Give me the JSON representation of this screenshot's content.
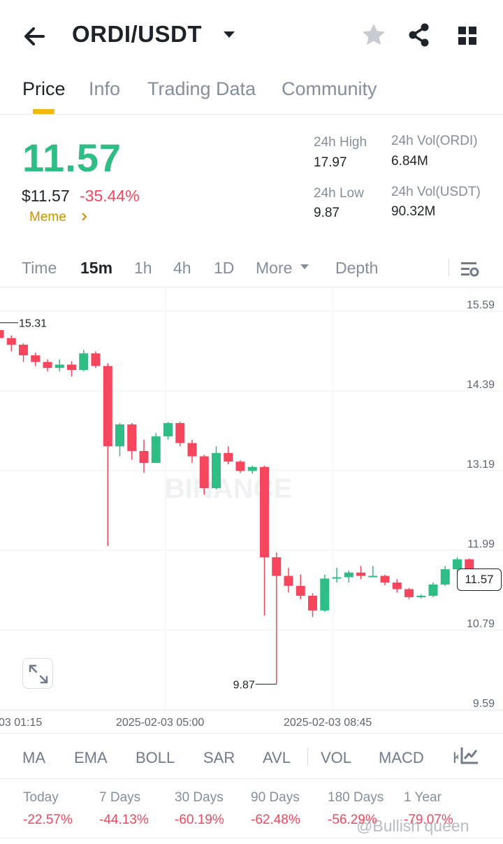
{
  "header": {
    "pair": "ORDI/USDT",
    "icons": [
      "back-arrow-icon",
      "caret-down-icon",
      "star-icon",
      "share-icon",
      "grid-icon"
    ]
  },
  "tabs": [
    {
      "label": "Price",
      "active": true
    },
    {
      "label": "Info",
      "active": false
    },
    {
      "label": "Trading Data",
      "active": false
    },
    {
      "label": "Community",
      "active": false
    }
  ],
  "price": {
    "last": "11.57",
    "usd": "$11.57",
    "change": "-35.44%",
    "tag": "Meme",
    "colors": {
      "up": "#2ebd85",
      "down": "#f6465d",
      "tag": "#c99400",
      "accent": "#f0b90b"
    }
  },
  "stats": {
    "high_label": "24h High",
    "high_value": "17.97",
    "low_label": "24h Low",
    "low_value": "9.87",
    "vol_base_label": "24h Vol(ORDI)",
    "vol_base_value": "6.84M",
    "vol_quote_label": "24h Vol(USDT)",
    "vol_quote_value": "90.32M"
  },
  "intervals": [
    {
      "label": "Time",
      "active": false
    },
    {
      "label": "15m",
      "active": true
    },
    {
      "label": "1h",
      "active": false
    },
    {
      "label": "4h",
      "active": false
    },
    {
      "label": "1D",
      "active": false
    },
    {
      "label": "More",
      "active": false
    },
    {
      "label": "Depth",
      "active": false
    }
  ],
  "chart_data": {
    "type": "candlestick",
    "y_ticks": [
      "15.59",
      "14.39",
      "13.19",
      "11.99",
      "10.79",
      "9.59"
    ],
    "ylim": [
      9.39,
      16.0
    ],
    "x_ticks": [
      "03 01:15",
      "2025-02-03 05:00",
      "2025-02-03 08:45"
    ],
    "high_marker": "15.31",
    "low_marker": "9.87",
    "last_price": "11.57",
    "watermark": "BINANCE",
    "candles": [
      {
        "o": 15.2,
        "h": 15.31,
        "l": 15.05,
        "c": 15.08
      },
      {
        "o": 15.08,
        "h": 15.12,
        "l": 14.88,
        "c": 14.98
      },
      {
        "o": 14.98,
        "h": 15.0,
        "l": 14.72,
        "c": 14.82
      },
      {
        "o": 14.82,
        "h": 14.86,
        "l": 14.66,
        "c": 14.72
      },
      {
        "o": 14.72,
        "h": 14.76,
        "l": 14.58,
        "c": 14.63
      },
      {
        "o": 14.63,
        "h": 14.76,
        "l": 14.58,
        "c": 14.68
      },
      {
        "o": 14.68,
        "h": 14.73,
        "l": 14.5,
        "c": 14.6
      },
      {
        "o": 14.6,
        "h": 14.9,
        "l": 14.58,
        "c": 14.85
      },
      {
        "o": 14.85,
        "h": 14.88,
        "l": 14.63,
        "c": 14.66
      },
      {
        "o": 14.66,
        "h": 14.7,
        "l": 11.95,
        "c": 13.45
      },
      {
        "o": 13.45,
        "h": 13.8,
        "l": 13.3,
        "c": 13.78
      },
      {
        "o": 13.78,
        "h": 13.8,
        "l": 13.25,
        "c": 13.38
      },
      {
        "o": 13.38,
        "h": 13.55,
        "l": 13.05,
        "c": 13.2
      },
      {
        "o": 13.2,
        "h": 13.65,
        "l": 13.2,
        "c": 13.6
      },
      {
        "o": 13.6,
        "h": 13.82,
        "l": 13.55,
        "c": 13.8
      },
      {
        "o": 13.8,
        "h": 13.82,
        "l": 13.45,
        "c": 13.5
      },
      {
        "o": 13.5,
        "h": 13.55,
        "l": 13.2,
        "c": 13.3
      },
      {
        "o": 13.3,
        "h": 13.32,
        "l": 12.72,
        "c": 12.82
      },
      {
        "o": 12.82,
        "h": 13.45,
        "l": 12.8,
        "c": 13.35
      },
      {
        "o": 13.35,
        "h": 13.45,
        "l": 13.18,
        "c": 13.22
      },
      {
        "o": 13.22,
        "h": 13.24,
        "l": 13.05,
        "c": 13.08
      },
      {
        "o": 13.08,
        "h": 13.16,
        "l": 13.04,
        "c": 13.14
      },
      {
        "o": 13.14,
        "h": 13.16,
        "l": 10.9,
        "c": 11.78
      },
      {
        "o": 11.78,
        "h": 11.85,
        "l": 9.87,
        "c": 11.5
      },
      {
        "o": 11.5,
        "h": 11.62,
        "l": 11.25,
        "c": 11.35
      },
      {
        "o": 11.35,
        "h": 11.52,
        "l": 11.15,
        "c": 11.2
      },
      {
        "o": 11.2,
        "h": 11.24,
        "l": 10.88,
        "c": 10.98
      },
      {
        "o": 10.98,
        "h": 11.52,
        "l": 10.96,
        "c": 11.46
      },
      {
        "o": 11.46,
        "h": 11.62,
        "l": 11.4,
        "c": 11.48
      },
      {
        "o": 11.48,
        "h": 11.58,
        "l": 11.4,
        "c": 11.55
      },
      {
        "o": 11.55,
        "h": 11.65,
        "l": 11.45,
        "c": 11.5
      },
      {
        "o": 11.5,
        "h": 11.65,
        "l": 11.48,
        "c": 11.5
      },
      {
        "o": 11.5,
        "h": 11.52,
        "l": 11.36,
        "c": 11.4
      },
      {
        "o": 11.4,
        "h": 11.45,
        "l": 11.25,
        "c": 11.3
      },
      {
        "o": 11.3,
        "h": 11.32,
        "l": 11.15,
        "c": 11.18
      },
      {
        "o": 11.18,
        "h": 11.22,
        "l": 11.16,
        "c": 11.2
      },
      {
        "o": 11.2,
        "h": 11.4,
        "l": 11.18,
        "c": 11.37
      },
      {
        "o": 11.37,
        "h": 11.65,
        "l": 11.35,
        "c": 11.6
      },
      {
        "o": 11.6,
        "h": 11.78,
        "l": 11.58,
        "c": 11.75
      },
      {
        "o": 11.75,
        "h": 11.76,
        "l": 11.55,
        "c": 11.57
      }
    ]
  },
  "indicators": [
    "MA",
    "EMA",
    "BOLL",
    "SAR",
    "AVL",
    "VOL",
    "MACD",
    "K"
  ],
  "performance": [
    {
      "label": "Today",
      "value": "-22.57%"
    },
    {
      "label": "7 Days",
      "value": "-44.13%"
    },
    {
      "label": "30 Days",
      "value": "-60.19%"
    },
    {
      "label": "90 Days",
      "value": "-62.48%"
    },
    {
      "label": "180 Days",
      "value": "-56.29%"
    },
    {
      "label": "1 Year",
      "value": "-79.07%"
    }
  ],
  "watermark": "@Bullish queen"
}
